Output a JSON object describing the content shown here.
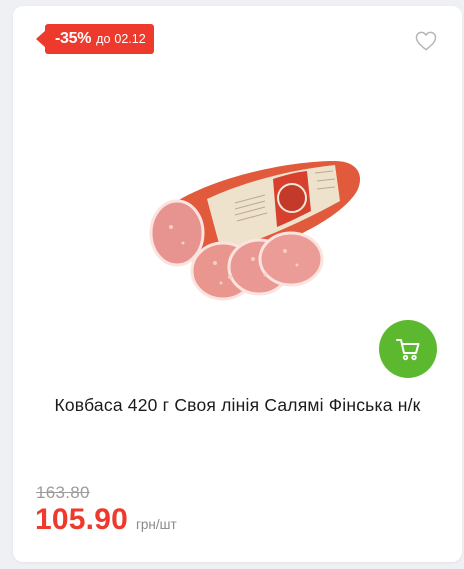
{
  "badge": {
    "discount": "-35%",
    "until_label": "до",
    "until_date": "02.12"
  },
  "product": {
    "title": "Ковбаса 420 г Своя лінія Салямі Фінська н/к",
    "old_price": "163.80",
    "new_price": "105.90",
    "unit": "грн/шт"
  },
  "icons": {
    "favorite": "heart-outline-icon",
    "cart": "cart-icon"
  },
  "colors": {
    "badge": "#ee3a2d",
    "price": "#ee3a2d",
    "cart_button": "#5cb82f",
    "old_price": "#9c9c9c"
  }
}
